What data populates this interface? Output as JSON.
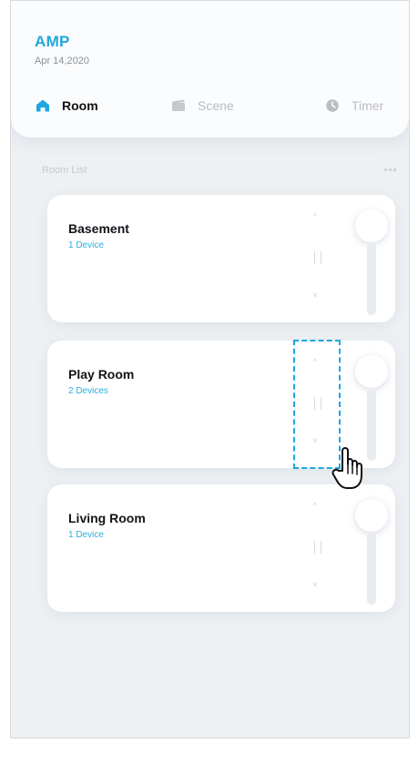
{
  "app": {
    "title": "AMP",
    "date": "Apr 14,2020"
  },
  "tabs": [
    {
      "label": "Room",
      "icon": "home-icon",
      "active": true
    },
    {
      "label": "Scene",
      "icon": "scene-icon",
      "active": false
    },
    {
      "label": "Timer",
      "icon": "clock-icon",
      "active": false
    }
  ],
  "room_list": {
    "title": "Room List",
    "more_icon": "more-icon",
    "items": [
      {
        "name": "Basement",
        "devices": "1 Device"
      },
      {
        "name": "Play Room",
        "devices": "2 Devices"
      },
      {
        "name": "Living Room",
        "devices": "1 Device"
      }
    ]
  },
  "colors": {
    "accent": "#1ea7dd",
    "background": "#eef1f4",
    "card": "#ffffff",
    "text": "#111418"
  }
}
